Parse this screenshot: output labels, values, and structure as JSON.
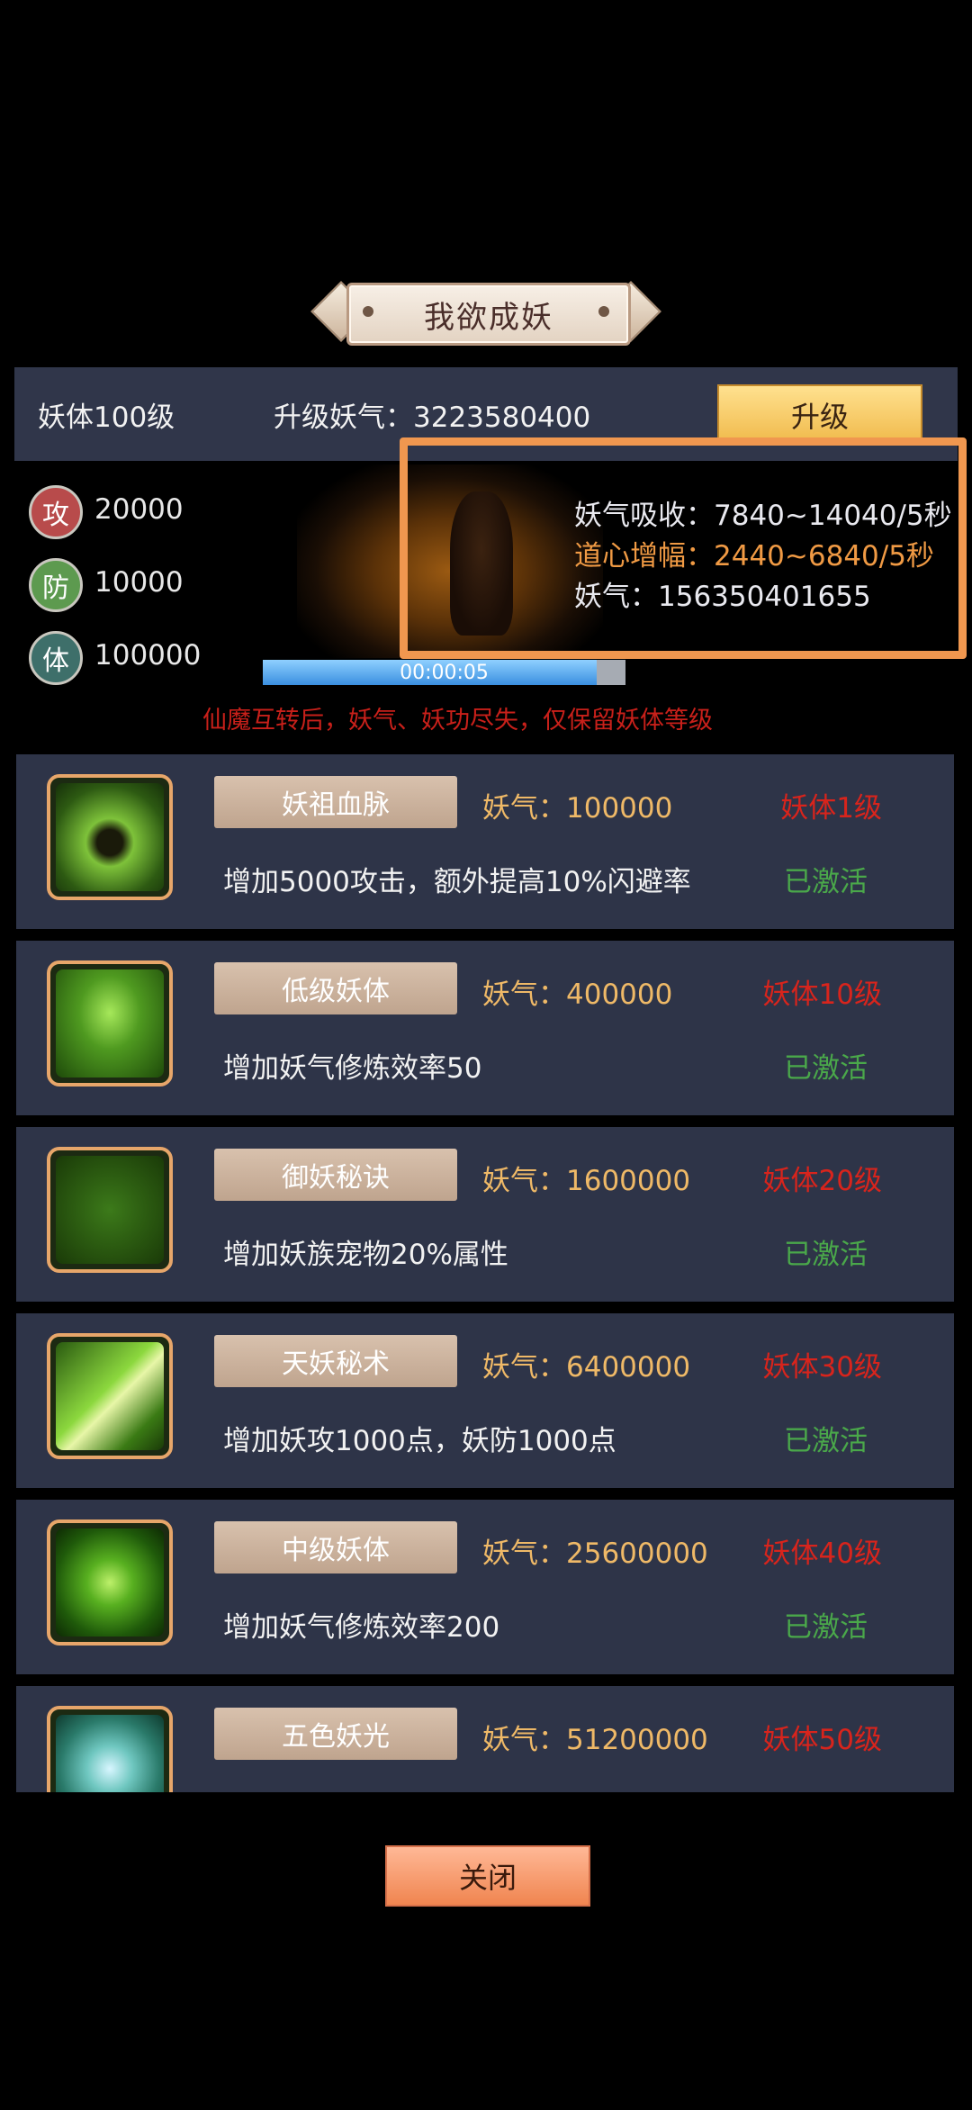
{
  "header": {
    "title": "我欲成妖"
  },
  "upgrade": {
    "level_text": "妖体100级",
    "cost_label": "升级妖气：",
    "cost_value": "3223580400",
    "button_label": "升级"
  },
  "stats": [
    {
      "icon_char": "攻",
      "value": "20000",
      "color": "#b84b4b"
    },
    {
      "icon_char": "防",
      "value": "10000",
      "color": "#5d9a4f"
    },
    {
      "icon_char": "体",
      "value": "100000",
      "color": "#3e6f6a"
    }
  ],
  "timer": {
    "text": "00:00:05",
    "progress": 0.92
  },
  "info": {
    "absorb": "妖气吸收：7840~14040/5秒",
    "boost": "道心增幅：2440~6840/5秒",
    "total": "妖气：156350401655"
  },
  "warning": "仙魔互转后，妖气、妖功尽失，仅保留妖体等级",
  "skills": [
    {
      "name": "妖祖血脉",
      "cost": "妖气：100000",
      "requirement": "妖体1级",
      "desc": "增加5000攻击，额外提高10%闪避率",
      "status": "已激活"
    },
    {
      "name": "低级妖体",
      "cost": "妖气：400000",
      "requirement": "妖体10级",
      "desc": "增加妖气修炼效率50",
      "status": "已激活"
    },
    {
      "name": "御妖秘诀",
      "cost": "妖气：1600000",
      "requirement": "妖体20级",
      "desc": "增加妖族宠物20%属性",
      "status": "已激活"
    },
    {
      "name": "天妖秘术",
      "cost": "妖气：6400000",
      "requirement": "妖体30级",
      "desc": "增加妖攻1000点，妖防1000点",
      "status": "已激活"
    },
    {
      "name": "中级妖体",
      "cost": "妖气：25600000",
      "requirement": "妖体40级",
      "desc": "增加妖气修炼效率200",
      "status": "已激活"
    },
    {
      "name": "五色妖光",
      "cost": "妖气：51200000",
      "requirement": "妖体50级",
      "desc": "",
      "status": ""
    }
  ],
  "footer": {
    "close_label": "关闭"
  },
  "colors": {
    "accent": "#f0974f",
    "active": "#4aa84a",
    "requirement": "#d8241c",
    "cost": "#efb967"
  }
}
